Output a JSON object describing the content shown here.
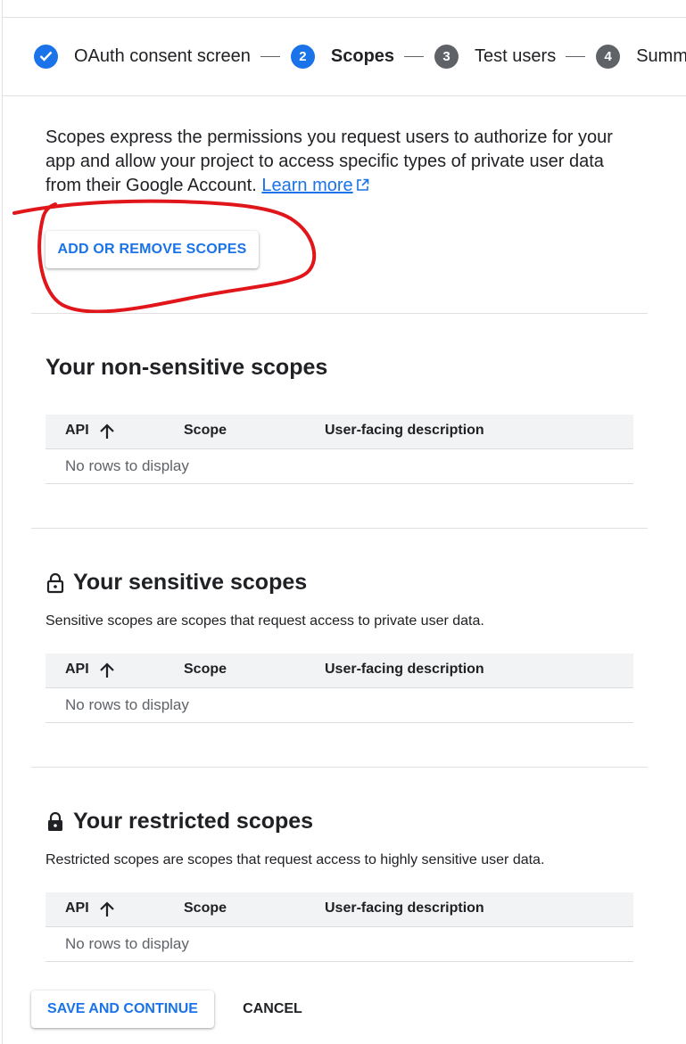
{
  "stepper": {
    "steps": [
      {
        "number": "",
        "label": "OAuth consent screen",
        "state": "done"
      },
      {
        "number": "2",
        "label": "Scopes",
        "state": "active"
      },
      {
        "number": "3",
        "label": "Test users",
        "state": "pending"
      },
      {
        "number": "4",
        "label": "Summ",
        "state": "pending"
      }
    ]
  },
  "intro": {
    "text": "Scopes express the permissions you request users to authorize for your app and allow your project to access specific types of private user data from their Google Account.",
    "link_label": "Learn more"
  },
  "add_scopes_label": "ADD OR REMOVE SCOPES",
  "table_headers": {
    "api": "API",
    "scope": "Scope",
    "description": "User-facing description"
  },
  "sections": {
    "non_sensitive": {
      "title": "Your non-sensitive scopes",
      "empty": "No rows to display"
    },
    "sensitive": {
      "title": "Your sensitive scopes",
      "subtitle": "Sensitive scopes are scopes that request access to private user data.",
      "empty": "No rows to display"
    },
    "restricted": {
      "title": "Your restricted scopes",
      "subtitle": "Restricted scopes are scopes that request access to highly sensitive user data.",
      "empty": "No rows to display"
    }
  },
  "footer": {
    "save_label": "SAVE AND CONTINUE",
    "cancel_label": "CANCEL"
  },
  "colors": {
    "accent": "#1a73e8",
    "annotation": "#e0161b",
    "pending_step": "#5f6368"
  },
  "icons": [
    "check-icon",
    "external-link-icon",
    "arrow-up-icon",
    "lock-open-icon",
    "lock-icon"
  ]
}
